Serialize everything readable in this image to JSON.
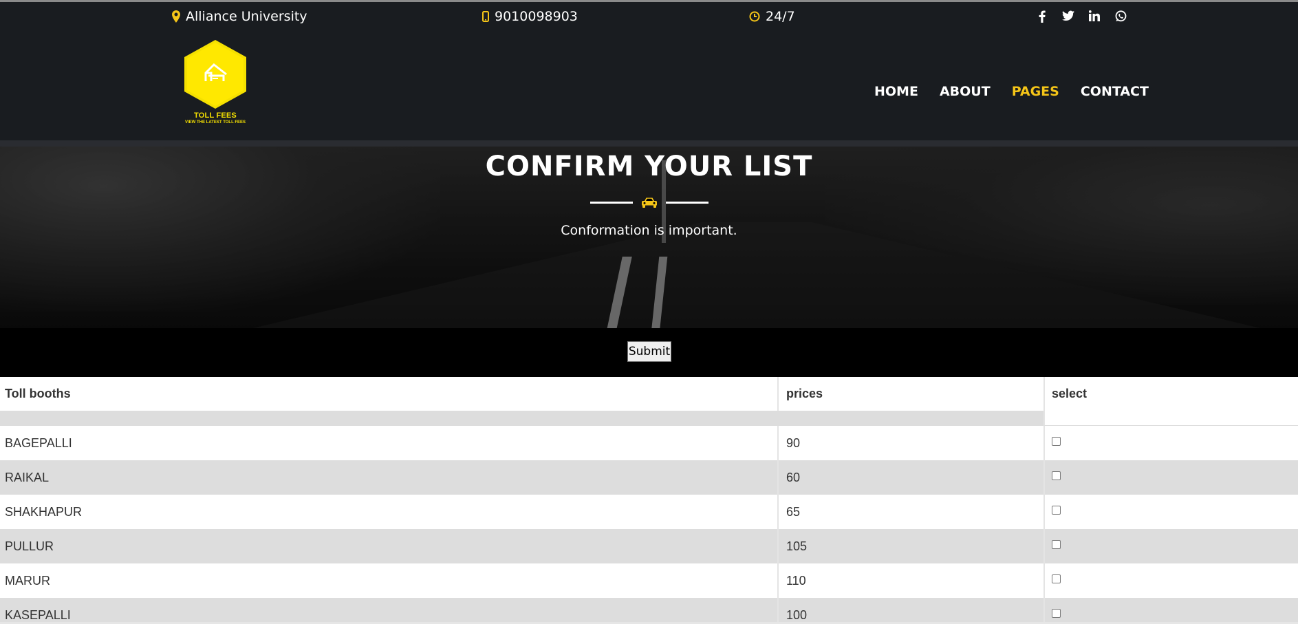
{
  "topbar": {
    "location": "Alliance University",
    "phone": "9010098903",
    "hours": "24/7",
    "location_icon": "map-marker-icon",
    "phone_icon": "mobile-phone-icon",
    "hours_icon": "clock-icon",
    "social": [
      "facebook-icon",
      "twitter-icon",
      "linkedin-icon",
      "whatsapp-icon"
    ]
  },
  "logo": {
    "title": "TOLL FEES",
    "tagline": "VIEW THE LATEST TOLL FEES"
  },
  "nav": {
    "items": [
      {
        "label": "HOME"
      },
      {
        "label": "ABOUT"
      },
      {
        "label": "PAGES"
      },
      {
        "label": "CONTACT"
      }
    ],
    "active": "PAGES"
  },
  "hero": {
    "title": "CONFIRM YOUR LIST",
    "subtitle": "Conformation is important.",
    "divider_icon": "car-icon"
  },
  "form": {
    "submit_label": "Submit"
  },
  "table": {
    "headers": [
      "Toll booths",
      "prices",
      "select"
    ],
    "rows": [
      {
        "name": "BAGEPALLI",
        "price": "90",
        "selected": false
      },
      {
        "name": "RAIKAL",
        "price": "60",
        "selected": false
      },
      {
        "name": "SHAKHAPUR",
        "price": "65",
        "selected": false
      },
      {
        "name": "PULLUR",
        "price": "105",
        "selected": false
      },
      {
        "name": "MARUR",
        "price": "110",
        "selected": false
      },
      {
        "name": "KASEPALLI",
        "price": "100",
        "selected": false
      }
    ]
  },
  "colors": {
    "accent": "#f5c518",
    "header_bg": "#191c20",
    "row_alt": "#dddddd"
  }
}
